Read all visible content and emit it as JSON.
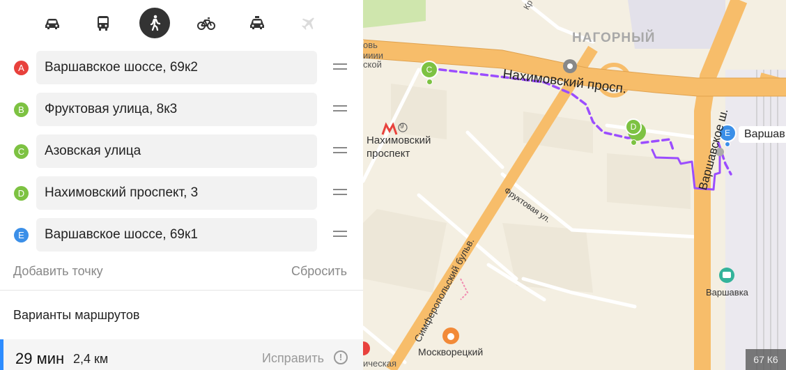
{
  "transport_modes": [
    {
      "name": "car",
      "icon": "car-icon",
      "active": false
    },
    {
      "name": "bus",
      "icon": "bus-icon",
      "active": false
    },
    {
      "name": "walk",
      "icon": "pedestrian-icon",
      "active": true
    },
    {
      "name": "bike",
      "icon": "bicycle-icon",
      "active": false
    },
    {
      "name": "taxi",
      "icon": "taxi-icon",
      "active": false
    },
    {
      "name": "plane",
      "icon": "plane-icon",
      "active": false,
      "disabled": true
    }
  ],
  "route_points": [
    {
      "marker": "A",
      "color": "#e8413c",
      "value": "Варшавское шоссе, 69к2"
    },
    {
      "marker": "B",
      "color": "#7dc242",
      "value": "Фруктовая улица, 8к3"
    },
    {
      "marker": "C",
      "color": "#7dc242",
      "value": "Азовская улица"
    },
    {
      "marker": "D",
      "color": "#7dc242",
      "value": "Нахимовский проспект, 3"
    },
    {
      "marker": "E",
      "color": "#3b8fe8",
      "value": "Варшавское шоссе, 69к1"
    }
  ],
  "actions": {
    "add_point": "Добавить точку",
    "reset": "Сбросить"
  },
  "variants_title": "Варианты маршрутов",
  "route": {
    "time": "29 мин",
    "distance": "2,4 км",
    "fix": "Исправить",
    "fix_icon": "!"
  },
  "map": {
    "labels": {
      "district": "НАГОРНЫЙ",
      "street_nakhimovsky": "Нахимовский просп.",
      "street_varshavskoe": "Варшавское ш.",
      "street_fruktovaya": "Фруктовая ул.",
      "street_simferopolsky": "Симферопольский бульв.",
      "metro_line1": "Нахимовский",
      "metro_line2": "проспект",
      "metro_m": "М",
      "metro_num": "9",
      "bus_stop": "Варшавка",
      "poi": "Москворецкий",
      "cut_top1": "овь",
      "cut_top2": "ииии",
      "cut_top3": "ской",
      "cut_bottom": "ическая",
      "cut_top_kr": "Кр",
      "marker_e_label": "Варшав"
    },
    "markers": {
      "c": "C",
      "d": "D",
      "e": "E"
    },
    "scale": "67 К6",
    "colors": {
      "route": "#9b4dff",
      "main_road": "#f7bd6a",
      "road": "#ffffff",
      "block": "#ede7d8",
      "green": "#cfe6ad"
    }
  }
}
